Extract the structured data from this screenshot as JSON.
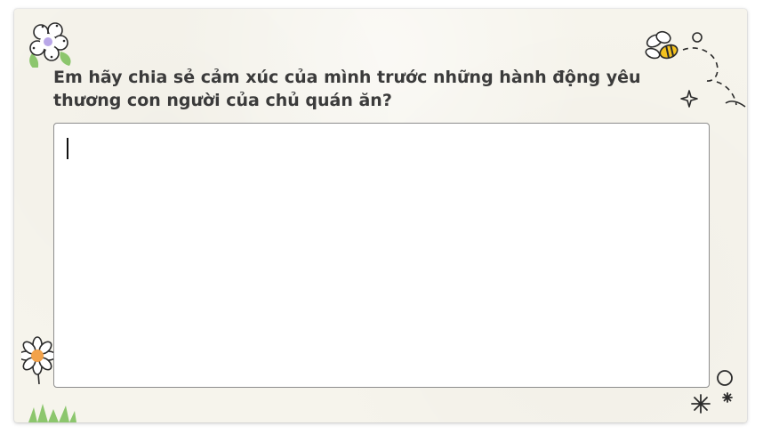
{
  "question": {
    "text": "Em hãy chia sẻ cảm xúc của mình trước những hành động yêu thương con người của chủ quán ăn?"
  },
  "answer": {
    "value": "",
    "placeholder": ""
  },
  "decorations": {
    "icons": [
      "flower-icon",
      "bee-icon",
      "star-icon",
      "daisy-icon",
      "circle-icon",
      "sparkle-icon",
      "grass-icon"
    ]
  },
  "colors": {
    "card_background": "#f6f4ec",
    "text": "#3b3b3b",
    "input_border": "#8d8d8d",
    "flower_accent": "#b9a7e8",
    "daisy_center": "#f2a24a",
    "leaf_green": "#8cc66d",
    "bee_yellow": "#f4c21f"
  }
}
